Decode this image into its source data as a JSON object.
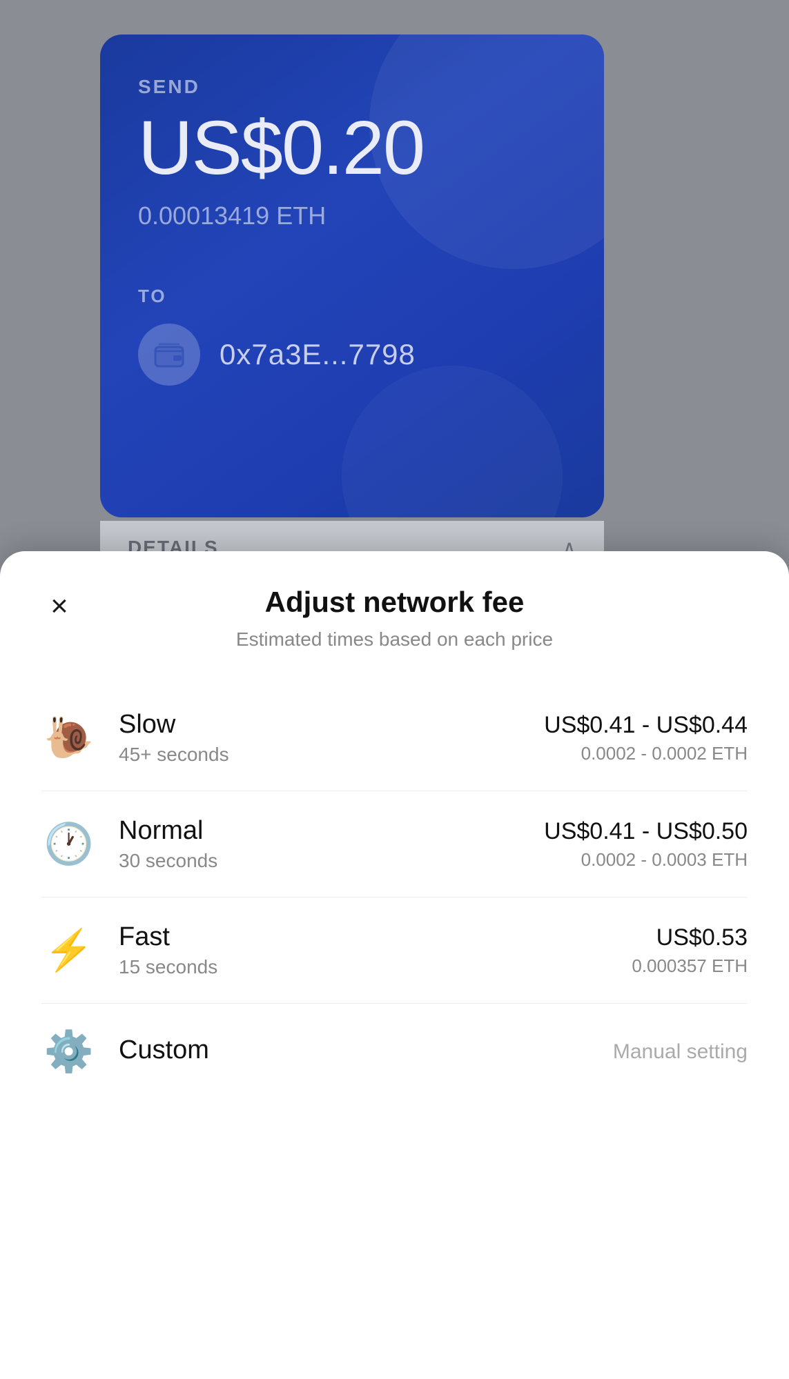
{
  "background": {
    "color": "#888a8e"
  },
  "send_card": {
    "send_label": "SEND",
    "amount_usd": "US$0.20",
    "amount_eth": "0.00013419 ETH",
    "to_label": "TO",
    "recipient_address": "0x7a3E...7798"
  },
  "details_bar": {
    "label": "DETAILS",
    "chevron": "⌃"
  },
  "bottom_sheet": {
    "close_icon": "×",
    "title": "Adjust network fee",
    "subtitle": "Estimated times based on each price",
    "fee_options": [
      {
        "emoji": "🐌",
        "name": "Slow",
        "time": "45+ seconds",
        "price_usd": "US$0.41 - US$0.44",
        "price_eth": "0.0002 - 0.0002 ETH",
        "manual": ""
      },
      {
        "emoji": "🕐",
        "name": "Normal",
        "time": "30 seconds",
        "price_usd": "US$0.41 - US$0.50",
        "price_eth": "0.0002 - 0.0003 ETH",
        "manual": ""
      },
      {
        "emoji": "⚡",
        "name": "Fast",
        "time": "15 seconds",
        "price_usd": "US$0.53",
        "price_eth": "0.000357 ETH",
        "manual": ""
      },
      {
        "emoji": "⚙️",
        "name": "Custom",
        "time": "",
        "price_usd": "",
        "price_eth": "",
        "manual": "Manual setting"
      }
    ]
  }
}
